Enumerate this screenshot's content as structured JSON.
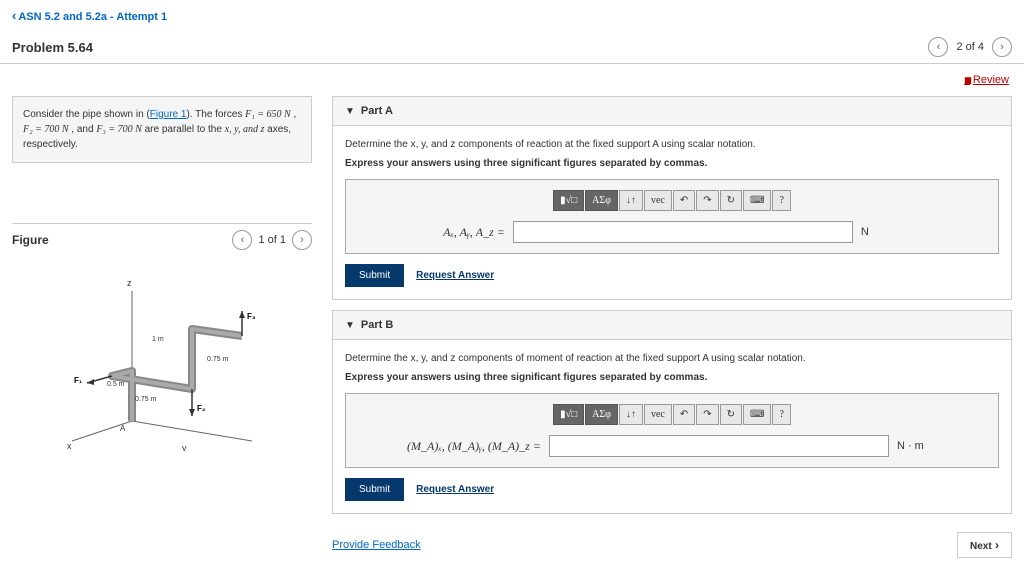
{
  "header": {
    "back_link": "ASN 5.2 and 5.2a - Attempt 1",
    "problem_title": "Problem 5.64",
    "nav_count": "2 of 4",
    "review": "Review"
  },
  "context": {
    "text_1": "Consider the pipe shown in (",
    "figure_link": "Figure 1",
    "text_2": "). The forces ",
    "f1": "F₁ = 650 N",
    "sep1": " , ",
    "f2": "F₂ = 700 N",
    "sep2": " , and ",
    "f3": "F₃ = 700 N",
    "text_3": " are parallel to the ",
    "axes": "x, y, and z",
    "text_4": " axes, respectively."
  },
  "figure": {
    "title": "Figure",
    "count": "1 of 1",
    "labels": {
      "z": "z",
      "y": "y",
      "x": "x",
      "f1": "F₁",
      "f2": "F₂",
      "f3": "F₃",
      "d1": "1 m",
      "d2": "0.5 m",
      "d3": "0.75 m",
      "d4": "0.75 m",
      "A": "A"
    }
  },
  "partA": {
    "title": "Part A",
    "instruction": "Determine the x, y, and z components of reaction at the fixed support A using scalar notation.",
    "instruction_bold": "Express your answers using three significant figures separated by commas.",
    "input_label": "Aₓ, Aᵧ, A_z =",
    "unit": "N",
    "submit": "Submit",
    "request": "Request Answer"
  },
  "partB": {
    "title": "Part B",
    "instruction": "Determine the x, y, and z components of moment of reaction at the fixed support A using scalar notation.",
    "instruction_bold": "Express your answers using three significant figures separated by commas.",
    "input_label": "(M_A)ₓ, (M_A)ᵧ, (M_A)_z =",
    "unit": "N · m",
    "submit": "Submit",
    "request": "Request Answer"
  },
  "toolbar": {
    "t1": "▮√□",
    "t2": "ΑΣφ",
    "t3": "↓↑",
    "t4": "vec",
    "t5": "↶",
    "t6": "↷",
    "t7": "↻",
    "t8": "⌨",
    "t9": "?"
  },
  "footer": {
    "feedback": "Provide Feedback",
    "next": "Next"
  }
}
